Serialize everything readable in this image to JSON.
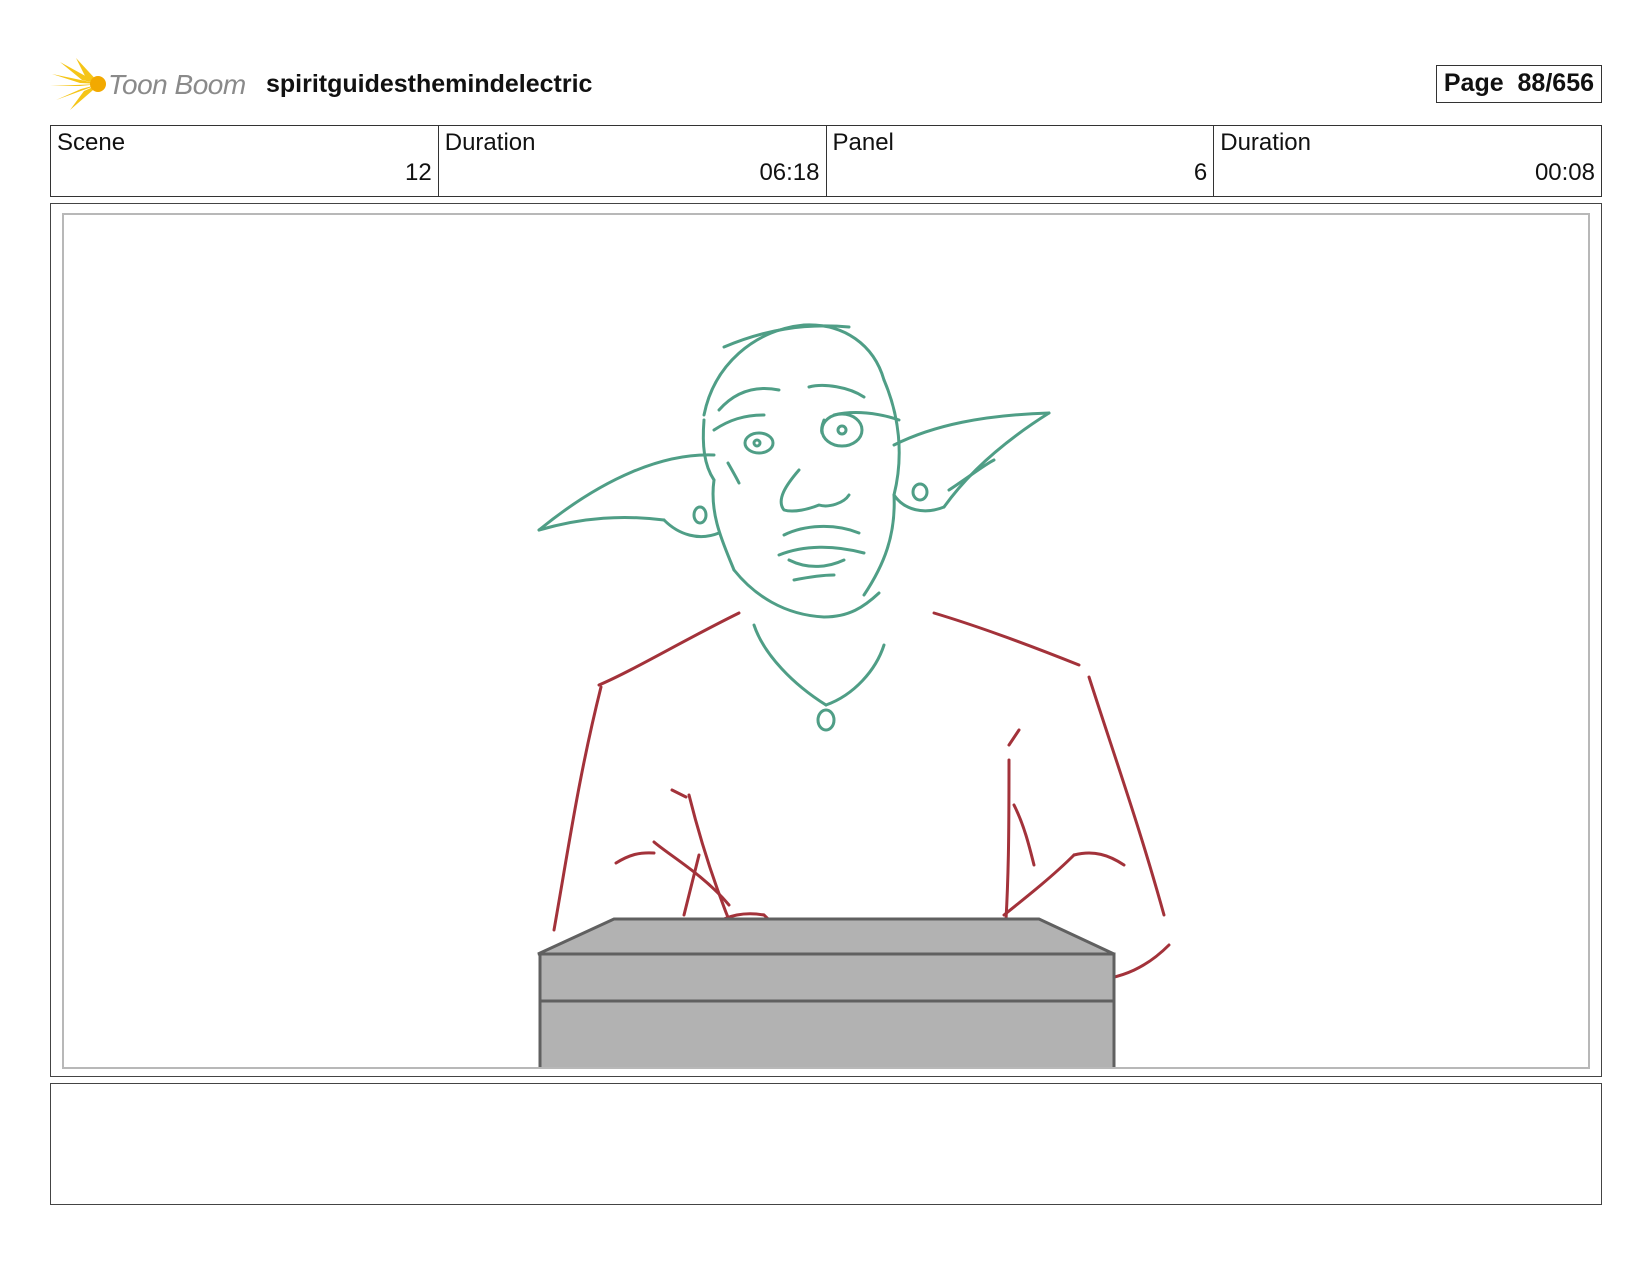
{
  "header": {
    "logo_text": "Toon Boom",
    "project_title": "spiritguidesthemindelectric",
    "page_label": "Page",
    "page_number": "88/656"
  },
  "info": {
    "scene_label": "Scene",
    "scene_value": "12",
    "scene_duration_label": "Duration",
    "scene_duration_value": "06:18",
    "panel_label": "Panel",
    "panel_value": "6",
    "panel_duration_label": "Duration",
    "panel_duration_value": "00:08"
  },
  "drawing": {
    "head_color": "#4f9e86",
    "body_color": "#a3323a",
    "desk_fill": "#b2b2b2",
    "desk_stroke": "#606060"
  },
  "notes": {
    "text": ""
  }
}
